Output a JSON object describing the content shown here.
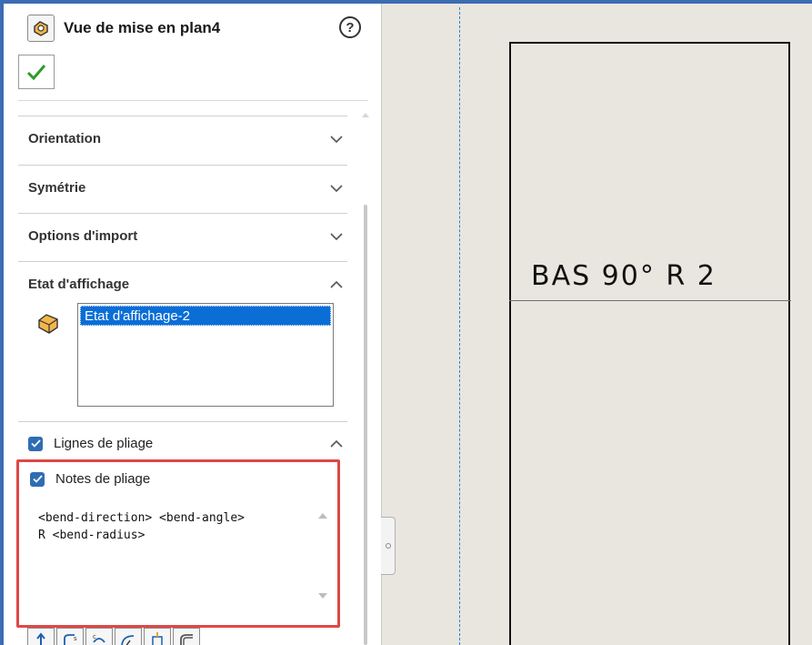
{
  "panel": {
    "title": "Vue de mise en plan4",
    "help_glyph": "?",
    "sections": [
      {
        "label": "Orientation",
        "state": "collapsed"
      },
      {
        "label": "Symétrie",
        "state": "collapsed"
      },
      {
        "label": "Options d'import",
        "state": "collapsed"
      },
      {
        "label": "Etat d'affichage",
        "state": "expanded"
      }
    ],
    "display_state": {
      "selected_item": "Etat d'affichage-2"
    },
    "bend_lines": {
      "label": "Lignes de pliage",
      "checked": true
    },
    "bend_notes": {
      "label": "Notes de pliage",
      "checked": true,
      "line1": "<bend-direction> <bend-angle>",
      "line2": "R <bend-radius>"
    },
    "toolbar_icons": [
      "bend-direction-icon",
      "bend-up-icon",
      "bend-down-icon",
      "bend-angle-icon",
      "bend-radius-icon",
      "bend-curve-icon"
    ]
  },
  "canvas": {
    "bend_note_text": "BAS 90° R 2"
  },
  "colors": {
    "accent_blue": "#3c6cb4",
    "selection_blue": "#0a6ed6",
    "highlight_red": "#e04747",
    "canvas_bg": "#e8e6df",
    "ok_green": "#2e9a2e"
  }
}
